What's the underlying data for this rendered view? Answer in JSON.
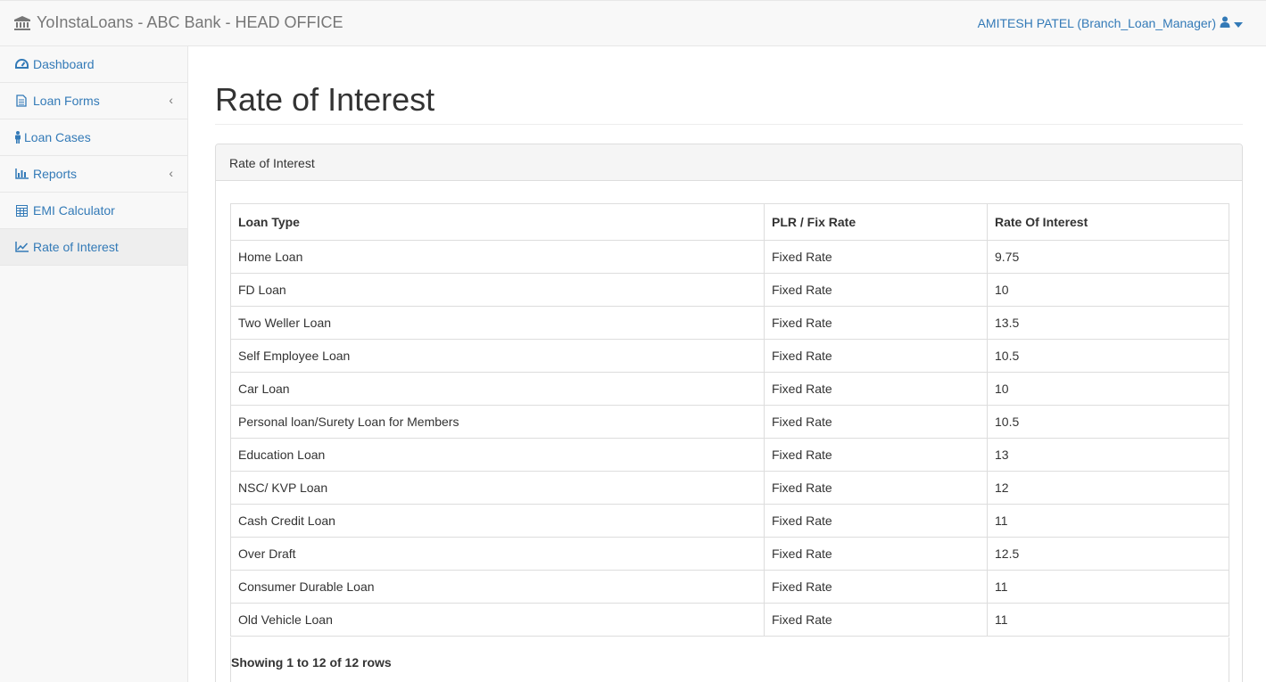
{
  "app": {
    "brand": "YoInstaLoans - ABC Bank - HEAD OFFICE",
    "user": "AMITESH PATEL (Branch_Loan_Manager)",
    "accent": "#337ab7"
  },
  "sidebar": {
    "items": [
      {
        "label": "Dashboard",
        "icon": "dashboard-icon"
      },
      {
        "label": "Loan Forms",
        "icon": "file-icon"
      },
      {
        "label": "Loan Cases",
        "icon": "person-icon"
      },
      {
        "label": "Reports",
        "icon": "bar-chart-icon"
      },
      {
        "label": "EMI Calculator",
        "icon": "calculator-icon"
      },
      {
        "label": "Rate of Interest",
        "icon": "line-chart-icon"
      }
    ]
  },
  "main": {
    "page_title": "Rate of Interest",
    "panel_title": "Rate of Interest",
    "table": {
      "headers": [
        "Loan Type",
        "PLR / Fix Rate",
        "Rate Of Interest"
      ],
      "rows": [
        [
          "Home Loan",
          "Fixed Rate",
          "9.75"
        ],
        [
          "FD Loan",
          "Fixed Rate",
          "10"
        ],
        [
          "Two Weller Loan",
          "Fixed Rate",
          "13.5"
        ],
        [
          "Self Employee Loan",
          "Fixed Rate",
          "10.5"
        ],
        [
          "Car Loan",
          "Fixed Rate",
          "10"
        ],
        [
          "Personal loan/Surety Loan for Members",
          "Fixed Rate",
          "10.5"
        ],
        [
          "Education Loan",
          "Fixed Rate",
          "13"
        ],
        [
          "NSC/ KVP Loan",
          "Fixed Rate",
          "12"
        ],
        [
          "Cash Credit Loan",
          "Fixed Rate",
          "11"
        ],
        [
          "Over Draft",
          "Fixed Rate",
          "12.5"
        ],
        [
          "Consumer Durable Loan",
          "Fixed Rate",
          "11"
        ],
        [
          "Old Vehicle Loan",
          "Fixed Rate",
          "11"
        ]
      ]
    },
    "pagination_info": "Showing 1 to 12 of 12 rows"
  }
}
